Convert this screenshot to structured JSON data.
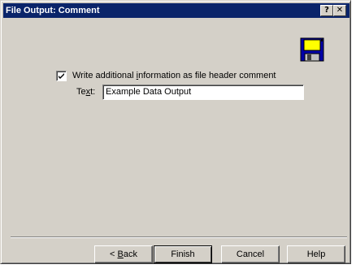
{
  "window": {
    "title": "File Output: Comment",
    "help_glyph": "?",
    "close_glyph": "✕"
  },
  "icons": {
    "save": "floppy-disk-icon"
  },
  "options": {
    "write_header_checked": true,
    "write_header_label_pre": "Write additional ",
    "write_header_label_access": "i",
    "write_header_label_post": "nformation as file header comment",
    "text_label_pre": "Te",
    "text_label_access": "x",
    "text_label_post": "t:",
    "text_value": "Example Data Output"
  },
  "buttons": {
    "back_pre": "< ",
    "back_access": "B",
    "back_post": "ack",
    "finish": "Finish",
    "cancel": "Cancel",
    "help": "Help"
  },
  "colors": {
    "titlebar": "#0a246a",
    "dialog_face": "#d4d0c8",
    "floppy_blue": "#0000a8",
    "floppy_label": "#ffff00"
  }
}
